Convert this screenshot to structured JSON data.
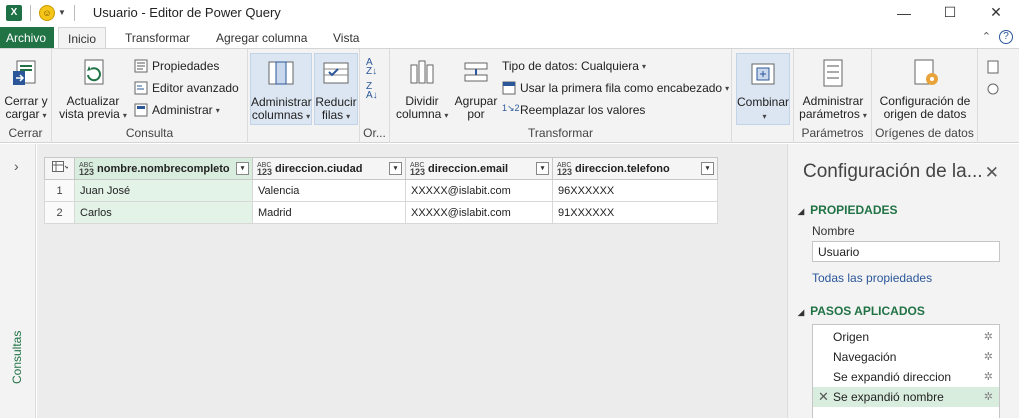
{
  "titlebar": {
    "app_icon_letter": "X",
    "title": "Usuario - Editor de Power Query",
    "min_glyph": "—",
    "max_glyph": "☐",
    "close_glyph": "✕"
  },
  "tabs": [
    {
      "label": "Archivo"
    },
    {
      "label": "Inicio"
    },
    {
      "label": "Transformar"
    },
    {
      "label": "Agregar columna"
    },
    {
      "label": "Vista"
    }
  ],
  "ribbon": {
    "cerrar": {
      "button": "Cerrar y\ncargar",
      "group": "Cerrar"
    },
    "consulta": {
      "refresh": "Actualizar\nvista previa",
      "propiedades": "Propiedades",
      "editor": "Editor avanzado",
      "administrar": "Administrar",
      "group": "Consulta"
    },
    "columnas": {
      "button": "Administrar\ncolumnas"
    },
    "filas": {
      "button": "Reducir\nfilas"
    },
    "ordenar": {
      "group": "Or..."
    },
    "transformar": {
      "dividir": "Dividir\ncolumna",
      "agrupar": "Agrupar\npor",
      "tipo": "Tipo de datos: Cualquiera",
      "primera_fila": "Usar la primera fila como encabezado",
      "reemplazar": "Reemplazar los valores",
      "group": "Transformar"
    },
    "combinar": {
      "button": "Combinar"
    },
    "parametros": {
      "button": "Administrar\nparámetros",
      "group": "Parámetros"
    },
    "origenes": {
      "button": "Configuración de\norigen de datos",
      "group": "Orígenes de datos"
    }
  },
  "left_pane": {
    "label": "Consultas"
  },
  "table": {
    "columns": [
      {
        "type_top": "ABC",
        "type_bottom": "123",
        "name": "nombre.nombrecompleto"
      },
      {
        "type_top": "ABC",
        "type_bottom": "123",
        "name": "direccion.ciudad"
      },
      {
        "type_top": "ABC",
        "type_bottom": "123",
        "name": "direccion.email"
      },
      {
        "type_top": "ABC",
        "type_bottom": "123",
        "name": "direccion.telefono"
      }
    ],
    "rows": [
      {
        "n": "1",
        "cells": [
          "Juan José",
          "Valencia",
          "XXXXX@islabit.com",
          "96XXXXXX"
        ]
      },
      {
        "n": "2",
        "cells": [
          "Carlos",
          "Madrid",
          "XXXXX@islabit.com",
          "91XXXXXX"
        ]
      }
    ]
  },
  "settings_pane": {
    "title": "Configuración de la...",
    "propiedades_header": "PROPIEDADES",
    "nombre_label": "Nombre",
    "nombre_value": "Usuario",
    "todas_link": "Todas las propiedades",
    "pasos_header": "PASOS APLICADOS",
    "steps": [
      {
        "label": "Origen"
      },
      {
        "label": "Navegación"
      },
      {
        "label": "Se expandió direccion"
      },
      {
        "label": "Se expandió nombre"
      }
    ]
  },
  "colors": {
    "accent": "#217346",
    "link": "#2b579a",
    "selection": "#d9eddf"
  }
}
